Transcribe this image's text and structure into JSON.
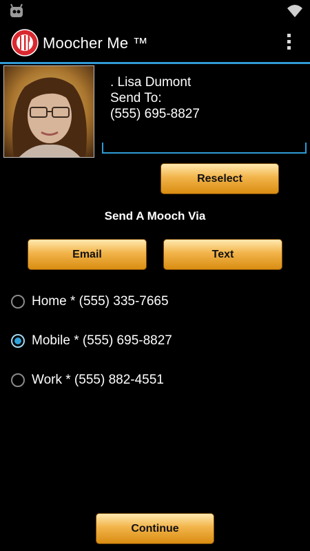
{
  "app": {
    "title": "Moocher Me ™"
  },
  "contact": {
    "name": ". Lisa Dumont",
    "send_to_label": "Send To:",
    "send_to_number": "(555) 695-8827"
  },
  "buttons": {
    "reselect": "Reselect",
    "email": "Email",
    "text": "Text",
    "continue": "Continue"
  },
  "section": {
    "send_via": "Send A Mooch Via"
  },
  "numbers": [
    {
      "label": "Home * (555) 335-7665",
      "selected": false
    },
    {
      "label": "Mobile * (555) 695-8827",
      "selected": true
    },
    {
      "label": "Work * (555) 882-4551",
      "selected": false
    }
  ],
  "colors": {
    "accent": "#2f9bd6",
    "button_gold": "#f2b44a",
    "logo_red": "#d9282f"
  },
  "icons": [
    "cyanogenmod-icon",
    "wifi-icon",
    "app-logo-icon",
    "overflow-menu-icon"
  ]
}
